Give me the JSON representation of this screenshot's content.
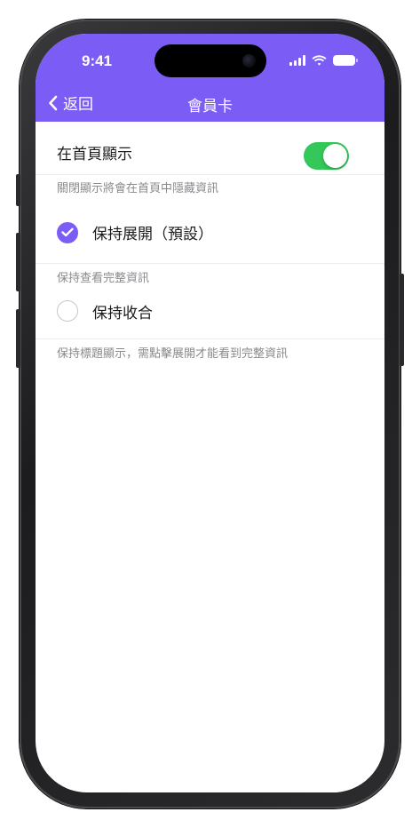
{
  "status_bar": {
    "time": "9:41"
  },
  "nav": {
    "back_label": "返回",
    "title": "會員卡"
  },
  "settings": {
    "show_on_home": {
      "label": "在首頁顯示",
      "enabled": true,
      "helper": "關閉顯示將會在首頁中隱藏資訊"
    },
    "options": [
      {
        "label": "保持展開（預設）",
        "selected": true,
        "helper": "保持查看完整資訊"
      },
      {
        "label": "保持收合",
        "selected": false,
        "helper": "保持標題顯示，需點擊展開才能看到完整資訊"
      }
    ]
  },
  "colors": {
    "accent": "#7b5cf5",
    "toggle_on": "#34c759",
    "helper_text": "#8a8a8e"
  }
}
